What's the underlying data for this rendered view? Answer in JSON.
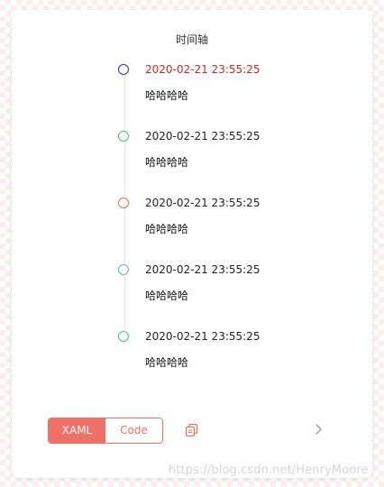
{
  "title": "时间轴",
  "timeline": [
    {
      "time": "2020-02-21 23:55:25",
      "text": "哈哈哈哈",
      "dot_color": "#2b2bd6",
      "time_color": "#e02020"
    },
    {
      "time": "2020-02-21 23:55:25",
      "text": "哈哈哈哈",
      "dot_color": "#3cc870",
      "time_color": "#222222"
    },
    {
      "time": "2020-02-21 23:55:25",
      "text": "哈哈哈哈",
      "dot_color": "#ef6a48",
      "time_color": "#222222"
    },
    {
      "time": "2020-02-21 23:55:25",
      "text": "哈哈哈哈",
      "dot_color": "#5aaee8",
      "time_color": "#222222"
    },
    {
      "time": "2020-02-21 23:55:25",
      "text": "哈哈哈哈",
      "dot_color": "#3cc870",
      "time_color": "#222222"
    }
  ],
  "toolbar": {
    "xaml_label": "XAML",
    "code_label": "Code",
    "copy_icon": "copy-icon",
    "next_icon": "chevron-right-icon",
    "accent_color": "#ef7066"
  },
  "watermark": "https://blog.csdn.net/HenryMoore"
}
